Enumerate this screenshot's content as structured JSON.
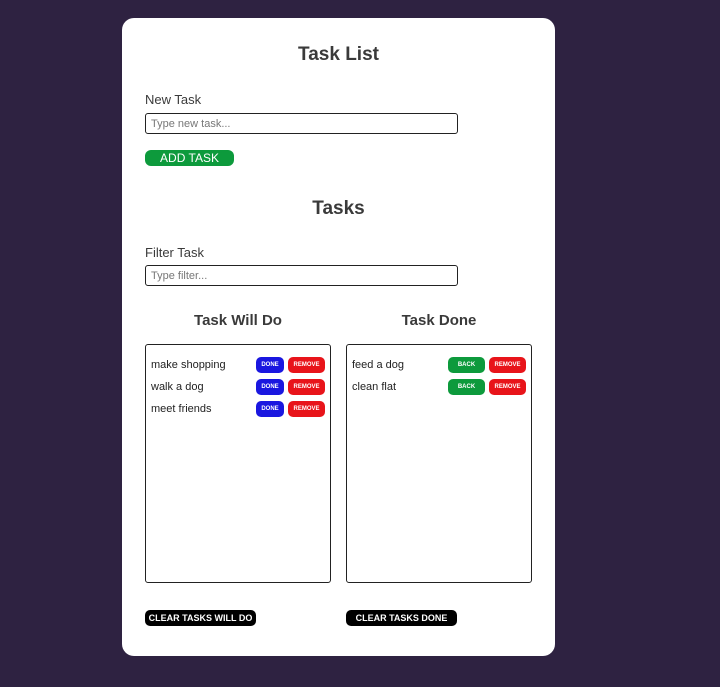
{
  "app": {
    "title": "Task List"
  },
  "new_task": {
    "label": "New Task",
    "placeholder": "Type new task...",
    "value": "",
    "add_label": "ADD TASK"
  },
  "tasks_section": {
    "title": "Tasks",
    "filter_label": "Filter Task",
    "filter_placeholder": "Type filter...",
    "filter_value": ""
  },
  "will_do": {
    "title": "Task Will Do",
    "items": [
      {
        "name": "make shopping",
        "done_label": "DONE",
        "remove_label": "REMOVE"
      },
      {
        "name": "walk a dog",
        "done_label": "DONE",
        "remove_label": "REMOVE"
      },
      {
        "name": "meet friends",
        "done_label": "DONE",
        "remove_label": "REMOVE"
      }
    ],
    "clear_label": "CLEAR TASKS WILL DO"
  },
  "done": {
    "title": "Task Done",
    "items": [
      {
        "name": "feed a dog",
        "back_label": "BACK",
        "remove_label": "REMOVE"
      },
      {
        "name": "clean flat",
        "back_label": "BACK",
        "remove_label": "REMOVE"
      }
    ],
    "clear_label": "CLEAR TASKS DONE"
  },
  "colors": {
    "background": "#2e2241",
    "card": "#ffffff",
    "add_button": "#0d9a3c",
    "done_button": "#1a17e0",
    "back_button": "#0d9a3c",
    "remove_button": "#e8141a",
    "clear_button": "#000000"
  }
}
